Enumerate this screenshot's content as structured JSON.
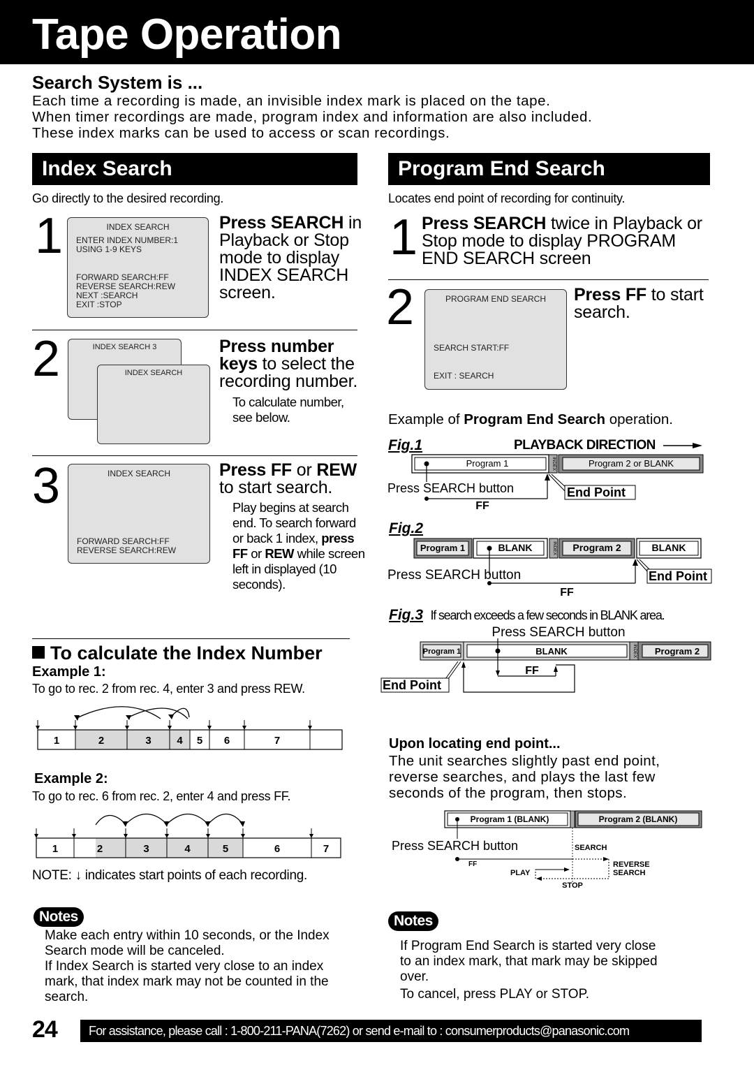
{
  "header": {
    "title": "Tape Operation"
  },
  "intro": {
    "heading": "Search System is ...",
    "lines": [
      "Each time a recording is made, an invisible index mark is placed on the tape.",
      "When timer recordings are made, program index and information are also included.",
      "These index marks can be used to access or scan recordings."
    ]
  },
  "index_search": {
    "title": "Index Search",
    "description": "Go directly to the desired recording.",
    "steps": [
      {
        "number": "1",
        "heading_bold": "Press SEARCH",
        "heading_rest": " in Playback or Stop mode to display INDEX SEARCH screen.",
        "screen": {
          "title": "INDEX SEARCH",
          "lines": [
            "ENTER INDEX NUMBER:1",
            "USING 1-9 KEYS",
            "",
            "",
            "FORWARD SEARCH:FF",
            "REVERSE SEARCH:REW",
            "NEXT :SEARCH",
            "EXIT :STOP"
          ]
        }
      },
      {
        "number": "2",
        "heading_bold": "Press number keys",
        "heading_rest": " to select the recording number.",
        "sub": "To calculate number, see below.",
        "screen_back": {
          "title": "INDEX SEARCH 3"
        },
        "screen_front": {
          "title": "INDEX SEARCH"
        }
      },
      {
        "number": "3",
        "heading_bold1": "Press FF",
        "heading_mid": " or ",
        "heading_bold2": "REW",
        "heading_rest": " to start search.",
        "sub_parts": [
          "Play begins at search end. To search forward or back 1 index, ",
          "press FF",
          " or ",
          "REW",
          " while screen left in displayed (10 seconds)."
        ],
        "screen": {
          "title": "INDEX SEARCH",
          "lines": [
            "FORWARD SEARCH:FF",
            "REVERSE SEARCH:REW"
          ]
        }
      }
    ],
    "calculate": {
      "heading": "To calculate the Index Number",
      "example1": {
        "label": "Example 1:",
        "description": "To go to rec. 2 from rec. 4, enter 3 and press REW.",
        "segments": [
          "1",
          "2",
          "3",
          "4",
          "5",
          "6",
          "7"
        ],
        "highlighted": [
          "2",
          "3",
          "4"
        ]
      },
      "example2": {
        "label": "Example 2:",
        "description": "To go to rec. 6 from rec. 2, enter 4 and press FF.",
        "segments": [
          "1",
          "2",
          "3",
          "4",
          "5",
          "6",
          "7"
        ],
        "highlighted": [
          "2",
          "3",
          "4",
          "5"
        ]
      },
      "note": "NOTE: ↓ indicates start points of each recording."
    },
    "notes": {
      "label": "Notes",
      "lines": [
        "Make each entry within 10 seconds, or the Index Search mode will be canceled.",
        "If Index Search is started very close to an index mark, that index mark may not be counted in the search."
      ]
    }
  },
  "program_end_search": {
    "title": "Program End Search",
    "description": "Locates end point of recording for continuity.",
    "steps": [
      {
        "number": "1",
        "heading_bold": "Press SEARCH",
        "heading_rest": " twice in Playback or Stop mode to display PROGRAM END SEARCH screen"
      },
      {
        "number": "2",
        "heading_bold": "Press FF",
        "heading_rest": " to start search.",
        "screen": {
          "title": "PROGRAM END SEARCH",
          "lines": [
            "SEARCH START:FF",
            "EXIT : SEARCH"
          ]
        }
      }
    ],
    "example_intro_pre": "Example of ",
    "example_intro_bold": "Program End Search",
    "example_intro_post": " operation.",
    "playback_direction": "PLAYBACK DIRECTION",
    "fig1": {
      "label": "Fig.1",
      "segments": [
        "Program 1",
        "Program 2 or BLANK"
      ],
      "index": "INDEX",
      "press": "Press SEARCH button",
      "end_point": "End Point",
      "ff": "FF"
    },
    "fig2": {
      "label": "Fig.2",
      "segments": [
        "Program 1",
        "BLANK",
        "Program 2",
        "BLANK"
      ],
      "index": "INDEX",
      "press": "Press SEARCH button",
      "end_point": "End Point",
      "ff": "FF"
    },
    "fig3": {
      "label": "Fig.3",
      "caption": "If search exceeds a few seconds in BLANK area.",
      "segments": [
        "Program 1",
        "BLANK",
        "Program 2"
      ],
      "index": "INDEX",
      "press": "Press SEARCH button",
      "end_point": "End Point",
      "ff": "FF"
    },
    "locating": {
      "heading": "Upon locating end point...",
      "lines": [
        "The unit searches slightly past end point,",
        "reverse searches, and plays the last few",
        "seconds of the program, then stops."
      ],
      "segments": [
        "Program 1 (BLANK)",
        "Program 2 (BLANK)"
      ],
      "press": "Press SEARCH button",
      "labels": {
        "search": "SEARCH",
        "ff": "FF",
        "play": "PLAY",
        "reverse1": "REVERSE",
        "reverse2": "SEARCH",
        "stop": "STOP"
      }
    },
    "notes": {
      "label": "Notes",
      "lines": [
        "If Program End Search is started very close to an index mark, that mark may be skipped over.",
        "To cancel, press PLAY or STOP."
      ]
    }
  },
  "footer": {
    "page_number": "24",
    "assistance": "For assistance, please call : 1-800-211-PANA(7262) or send e-mail to : consumerproducts@panasonic.com"
  }
}
